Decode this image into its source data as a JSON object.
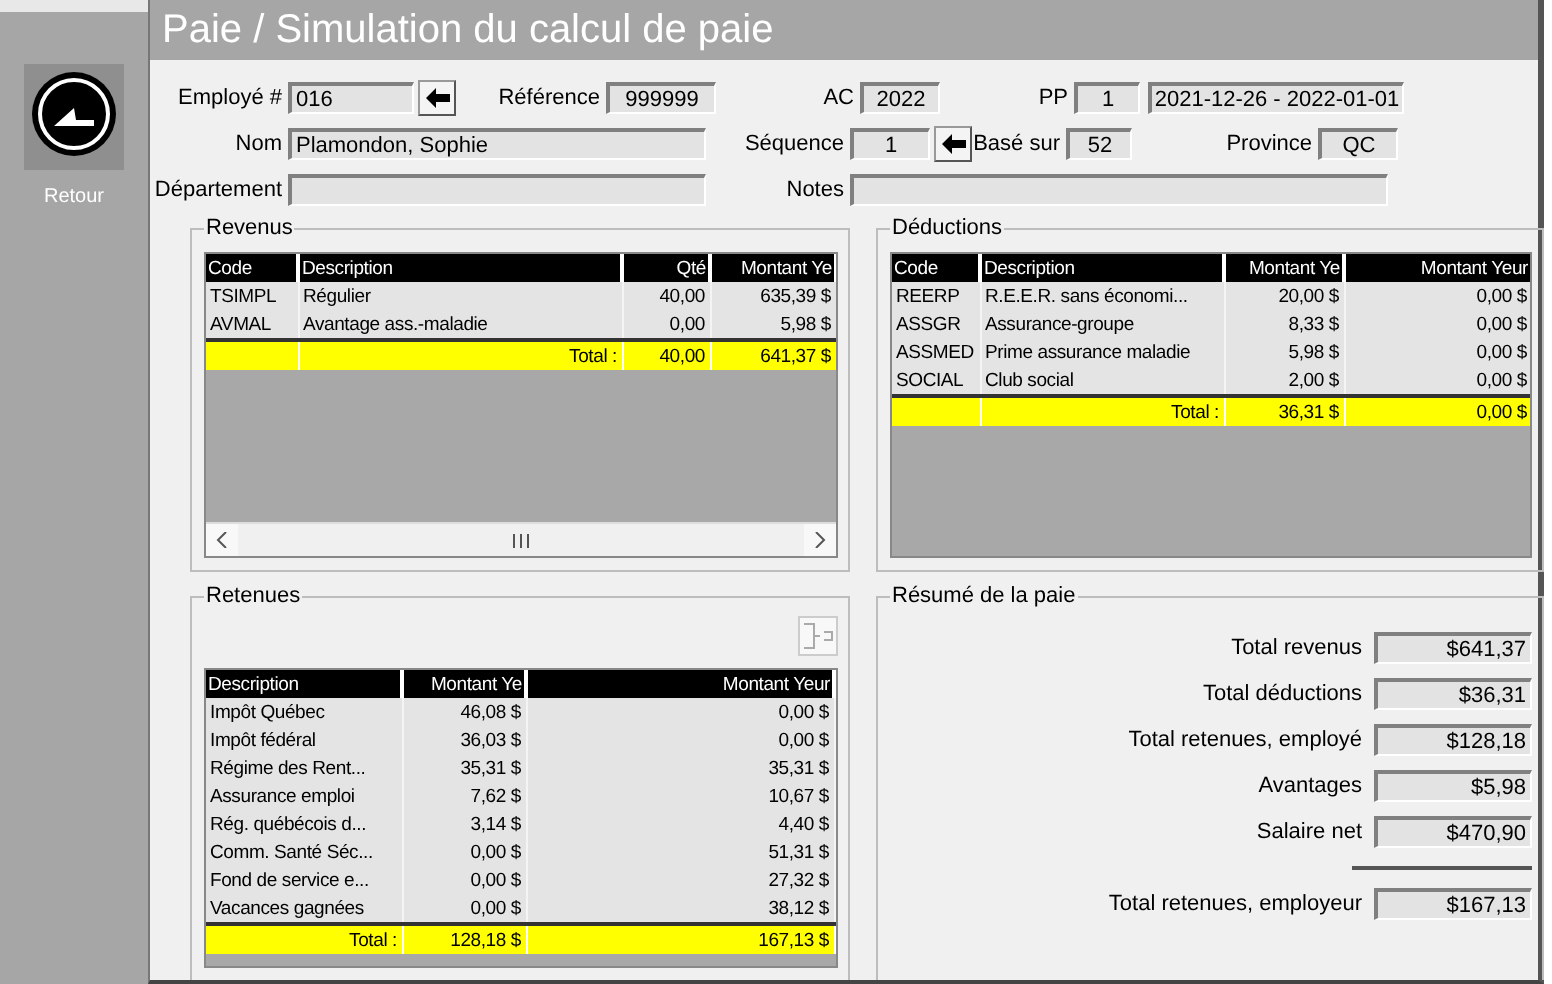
{
  "window": {
    "title": "Paie / Simulation du calcul de paie"
  },
  "back_button": {
    "label": "Retour"
  },
  "header": {
    "employe": {
      "label": "Employé #",
      "value": "016"
    },
    "reference": {
      "label": "Référence",
      "value": "999999"
    },
    "ac": {
      "label": "AC",
      "value": "2022"
    },
    "pp": {
      "label": "PP",
      "value": "1"
    },
    "periode": {
      "value": "2021-12-26  -  2022-01-01"
    },
    "nom": {
      "label": "Nom",
      "value": "Plamondon, Sophie"
    },
    "sequence": {
      "label": "Séquence",
      "value": "1"
    },
    "base_sur": {
      "label": "Basé sur",
      "value": "52"
    },
    "province": {
      "label": "Province",
      "value": "QC"
    },
    "departement": {
      "label": "Département"
    },
    "notes": {
      "label": "Notes"
    }
  },
  "revenus": {
    "title": "Revenus",
    "columns": [
      "Code",
      "Description",
      "Qté",
      "Montant Ye"
    ],
    "rows": [
      [
        "TSIMPL",
        "Régulier",
        "40,00",
        "635,39 $"
      ],
      [
        "AVMAL",
        "Avantage ass.-maladie",
        "0,00",
        "5,98 $"
      ]
    ],
    "total": {
      "label": "Total :",
      "values": [
        "40,00",
        "641,37 $"
      ]
    }
  },
  "deductions": {
    "title": "Déductions",
    "columns": [
      "Code",
      "Description",
      "Montant Ye",
      "Montant Yeur"
    ],
    "rows": [
      [
        "REERP",
        "R.E.E.R. sans économi...",
        "20,00 $",
        "0,00 $"
      ],
      [
        "ASSGR",
        "Assurance-groupe",
        "8,33 $",
        "0,00 $"
      ],
      [
        "ASSMED",
        "Prime assurance maladie",
        "5,98 $",
        "0,00 $"
      ],
      [
        "SOCIAL",
        "Club social",
        "2,00 $",
        "0,00 $"
      ]
    ],
    "total": {
      "label": "Total :",
      "values": [
        "36,31 $",
        "0,00 $"
      ]
    }
  },
  "retenues": {
    "title": "Retenues",
    "columns": [
      "Description",
      "Montant Ye",
      "Montant Yeur"
    ],
    "rows": [
      [
        "Impôt Québec",
        "46,08 $",
        "0,00 $"
      ],
      [
        "Impôt fédéral",
        "36,03 $",
        "0,00 $"
      ],
      [
        "Régime des Rent...",
        "35,31 $",
        "35,31 $"
      ],
      [
        "Assurance emploi",
        "7,62 $",
        "10,67 $"
      ],
      [
        "Rég. québécois d...",
        "3,14 $",
        "4,40 $"
      ],
      [
        "Comm. Santé Séc...",
        "0,00 $",
        "51,31 $"
      ],
      [
        "Fond de service e...",
        "0,00 $",
        "27,32 $"
      ],
      [
        "Vacances gagnées",
        "0,00 $",
        "38,12 $"
      ]
    ],
    "total": {
      "label": "Total :",
      "values": [
        "128,18 $",
        "167,13 $"
      ]
    }
  },
  "resume": {
    "title": "Résumé de la paie",
    "items": [
      {
        "kind": "amount",
        "label": "Total revenus",
        "value": "$641,37"
      },
      {
        "kind": "amount",
        "label": "Total déductions",
        "value": "$36,31"
      },
      {
        "kind": "amount",
        "label": "Total retenues, employé",
        "value": "$128,18"
      },
      {
        "kind": "amount",
        "label": "Avantages",
        "value": "$5,98"
      },
      {
        "kind": "amount",
        "label": "Salaire net",
        "value": "$470,90"
      },
      {
        "kind": "employer",
        "label": "Total retenues, employeur",
        "value": "$167,13"
      }
    ]
  }
}
